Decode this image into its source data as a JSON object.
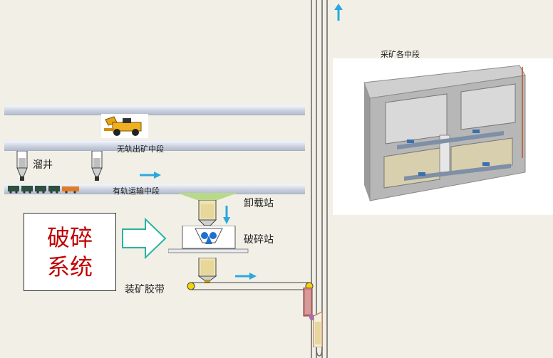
{
  "labels": {
    "trackless_level": "无轨出矿中段",
    "ore_pass": "溜井",
    "rail_level": "有轨运输中段",
    "unloading_station": "卸载站",
    "crushing_station": "破碎站",
    "loading_belt": "装矿胶带",
    "mining_level": "采矿各中段"
  },
  "system_box": {
    "line1": "破碎",
    "line2": "系统"
  },
  "colors": {
    "system_text": "#c00000",
    "flow_arrow": "#29a9e0",
    "background": "#f2f0e6"
  }
}
